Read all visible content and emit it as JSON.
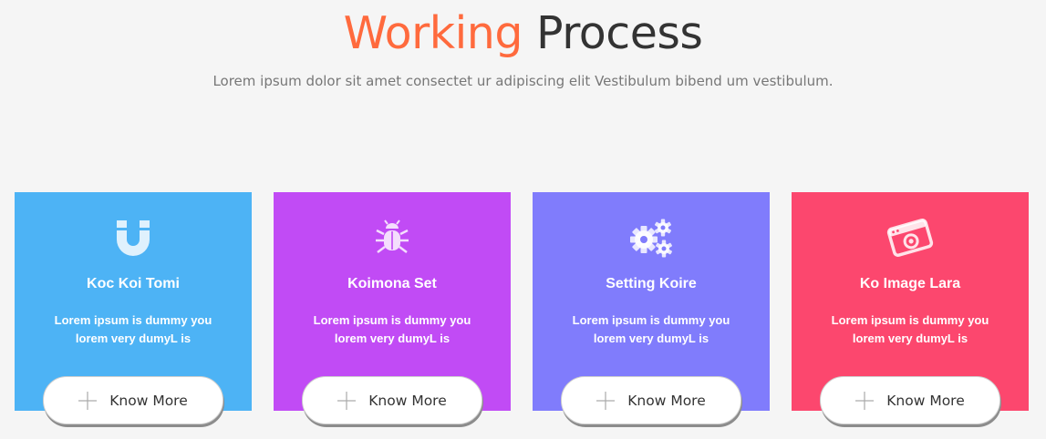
{
  "header": {
    "title_accent": "Working",
    "title_rest": "Process",
    "subtitle": "Lorem ipsum dolor sit amet consectet ur adipiscing elit Vestibulum bibend um vestibulum."
  },
  "colors": {
    "accent": "#ff6a3d",
    "title_dark": "#333333",
    "background": "#f5f5f5"
  },
  "cards": [
    {
      "title": "Koc Koi Tomi",
      "text": "Lorem ipsum is dummy you lorem very dumyL is",
      "icon": "magnet-icon",
      "color": "#4db3f5",
      "button_label": "Know More"
    },
    {
      "title": "Koimona Set",
      "text": "Lorem ipsum is dummy you lorem very dumyL is",
      "icon": "bug-icon",
      "color": "#c14bf5",
      "button_label": "Know More"
    },
    {
      "title": "Setting Koire",
      "text": "Lorem ipsum is dummy you lorem very dumyL is",
      "icon": "gears-icon",
      "color": "#807cfc",
      "button_label": "Know More"
    },
    {
      "title": "Ko Image Lara",
      "text": "Lorem ipsum is dummy you lorem very dumyL is",
      "icon": "image-icon",
      "color": "#fc476e",
      "button_label": "Know More"
    }
  ]
}
